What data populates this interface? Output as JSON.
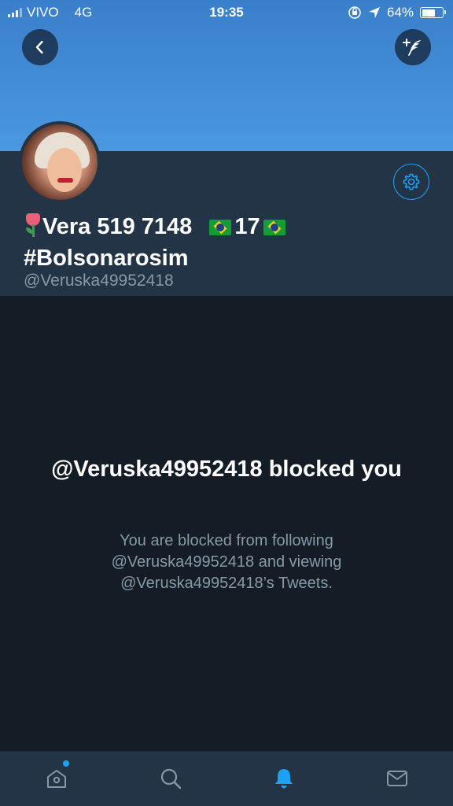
{
  "status_bar": {
    "carrier": "VIVO",
    "network": "4G",
    "time": "19:35",
    "battery_percent": "64%",
    "battery_level": 0.64
  },
  "header": {
    "back_icon": "chevron-left-icon",
    "compose_icon": "compose-feather-icon"
  },
  "profile": {
    "display_name_line1": "Vera 519 7148",
    "display_name_number": "17",
    "display_name_line2": "#Bolsonarosim",
    "handle": "@Veruska49952418",
    "settings_icon": "gear-icon"
  },
  "blocked": {
    "title": "@Veruska49952418 blocked you",
    "line1": "You are blocked from following",
    "line2": "@Veruska49952418 and viewing",
    "line3": "@Veruska49952418’s Tweets."
  },
  "tabbar": {
    "tabs": [
      {
        "icon": "home-icon",
        "active": false,
        "has_badge": true
      },
      {
        "icon": "search-icon",
        "active": false
      },
      {
        "icon": "bell-icon",
        "active": true
      },
      {
        "icon": "mail-icon",
        "active": false
      }
    ]
  },
  "colors": {
    "accent": "#1da1f2",
    "background": "#141d26",
    "panel": "#243447",
    "secondary_text": "#8899a6"
  }
}
